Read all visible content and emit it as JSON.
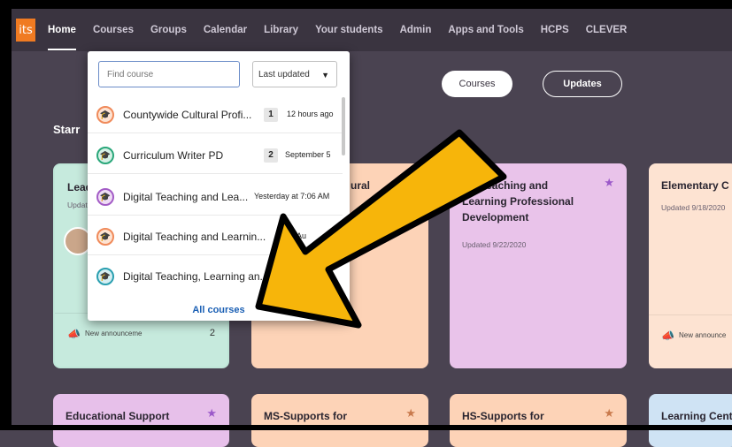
{
  "nav": {
    "logo": "its",
    "items": [
      "Home",
      "Courses",
      "Groups",
      "Calendar",
      "Library",
      "Your students",
      "Admin",
      "Apps and Tools",
      "HCPS",
      "CLEVER"
    ]
  },
  "main": {
    "section_label": "Starr",
    "pills": {
      "courses": "Courses",
      "updates": "Updates"
    }
  },
  "cards": [
    {
      "title": "Lead",
      "updated": "Updat",
      "announce_text": "New announceme",
      "announce_count": "2"
    },
    {
      "title": "ural",
      "updated": ""
    },
    {
      "title_l1": "ital Teaching and",
      "title_l2": "Learning Professional",
      "title_l3": "Development",
      "updated": "Updated 9/22/2020"
    },
    {
      "title": "Elementary C",
      "updated": "Updated 9/18/2020",
      "announce_text": "New announce"
    },
    {
      "title": "Educational Support"
    },
    {
      "title": "MS-Supports for"
    },
    {
      "title": "HS-Supports for"
    },
    {
      "title": "Learning Cent"
    }
  ],
  "dropdown": {
    "search_placeholder": "Find course",
    "sort_value": "Last updated",
    "courses": [
      {
        "name": "Countywide Cultural Profi...",
        "badge": "1",
        "time": "12 hours ago",
        "color": "#f08a5a"
      },
      {
        "name": "Curriculum Writer PD",
        "badge": "2",
        "time": "September 5",
        "color": "#2aa77a"
      },
      {
        "name": "Digital Teaching and Lea...",
        "badge": "",
        "time": "Yesterday at 7:06 AM",
        "color": "#a35cc6"
      },
      {
        "name": "Digital Teaching and Learnin...",
        "badge": "",
        "time": "Au",
        "color": "#f08a5a"
      },
      {
        "name": "Digital Teaching, Learning an...",
        "badge": "",
        "time": "",
        "color": "#2a9fb0"
      }
    ],
    "all_courses": "All courses"
  },
  "colors": {
    "arrow_fill": "#f7b50a",
    "arrow_stroke": "#000000",
    "link": "#1a5fb4"
  }
}
